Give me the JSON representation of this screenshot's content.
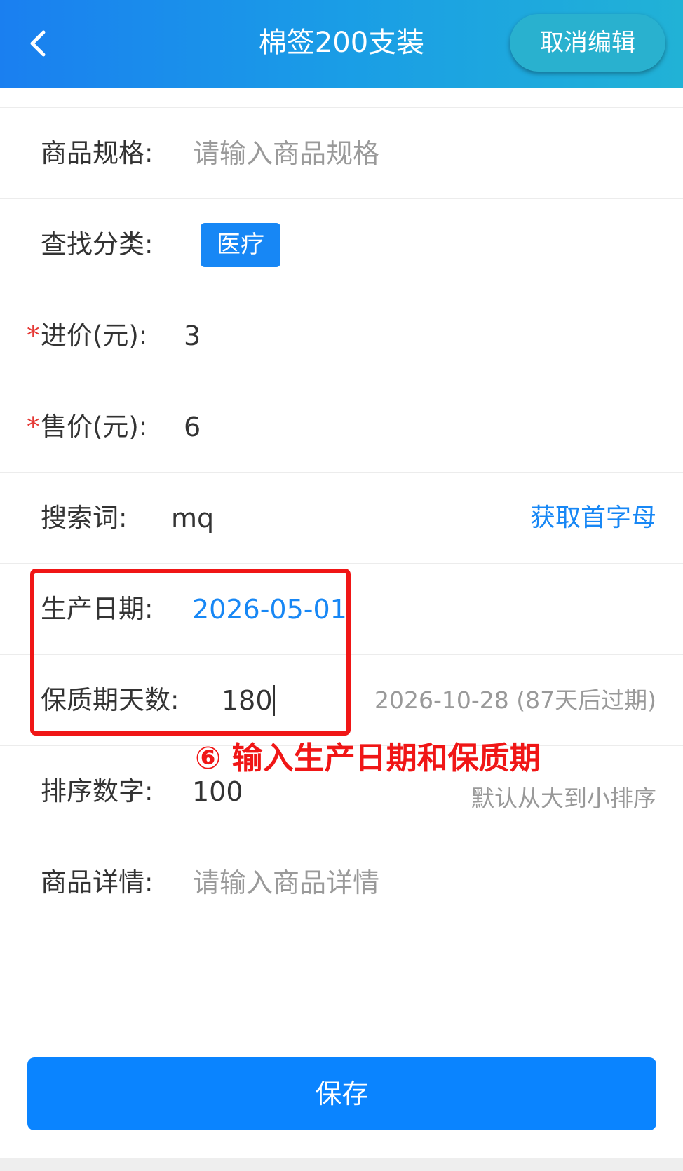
{
  "header": {
    "title": "棉签200支装",
    "cancel_label": "取消编辑",
    "back_icon": "chevron-left-icon",
    "gradient": [
      "#1a7ff0",
      "#21b2d6"
    ]
  },
  "form": {
    "spec": {
      "label": "商品规格:",
      "placeholder": "请输入商品规格"
    },
    "category": {
      "label": "查找分类:",
      "tag": "医疗"
    },
    "purchase_price": {
      "required_mark": "*",
      "label": "进价(元):",
      "value": "3"
    },
    "sale_price": {
      "required_mark": "*",
      "label": "售价(元):",
      "value": "6"
    },
    "search_word": {
      "label": "搜索词:",
      "value": "mq",
      "action": "获取首字母"
    },
    "production_date": {
      "label": "生产日期:",
      "value": "2026-05-01"
    },
    "shelf_life": {
      "label": "保质期天数:",
      "value": "180",
      "hint": "2026-10-28 (87天后过期)"
    },
    "sort_number": {
      "label": "排序数字:",
      "value": "100",
      "hint": "默认从大到小排序"
    },
    "detail": {
      "label": "商品详情:",
      "placeholder": "请输入商品详情"
    }
  },
  "annotation": {
    "text": "⑥ 输入生产日期和保质期",
    "color": "#f01616"
  },
  "footer": {
    "save_label": "保存",
    "accent": "#0a84ff"
  }
}
